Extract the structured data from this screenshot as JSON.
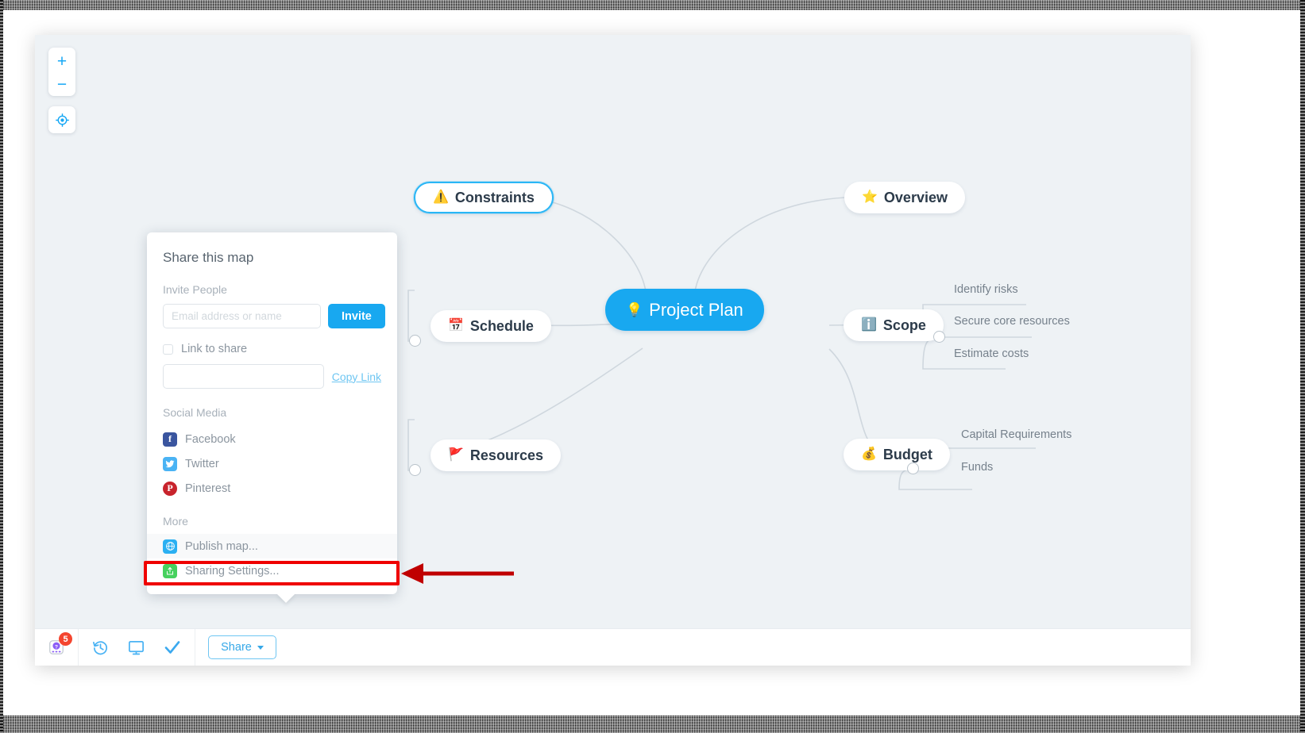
{
  "app": {
    "canvas_background": "#eef2f5",
    "accent": "#18a8f0"
  },
  "zoom_controls": {
    "zoom_in_label": "+",
    "zoom_out_label": "−",
    "recenter_name": "recenter-icon"
  },
  "mindmap": {
    "root": {
      "label": "Project Plan",
      "emoji": "💡"
    },
    "branches": [
      {
        "label": "Constraints",
        "emoji": "⚠️",
        "selected": true
      },
      {
        "label": "Overview",
        "emoji": "⭐",
        "selected": false
      },
      {
        "label": "Schedule",
        "emoji": "📅",
        "selected": false
      },
      {
        "label": "Scope",
        "emoji": "ℹ️",
        "selected": false
      },
      {
        "label": "Resources",
        "emoji": "🚩",
        "selected": false
      },
      {
        "label": "Budget",
        "emoji": "💰",
        "selected": false
      }
    ],
    "scope_children": [
      "Identify risks",
      "Secure core resources",
      "Estimate costs"
    ],
    "budget_children": [
      "Capital Requirements",
      "Funds"
    ]
  },
  "share_popover": {
    "title": "Share this map",
    "invite_section_label": "Invite People",
    "invite_placeholder": "Email address or name",
    "invite_value": "",
    "invite_button": "Invite",
    "link_to_share_label": "Link to share",
    "link_value": "",
    "copy_link_label": "Copy Link",
    "social_section_label": "Social Media",
    "social": [
      {
        "label": "Facebook",
        "icon": "facebook-icon",
        "glyph": "f",
        "color": "#3a559f"
      },
      {
        "label": "Twitter",
        "icon": "twitter-icon",
        "glyph": "🐦",
        "color": "#4ab3f4"
      },
      {
        "label": "Pinterest",
        "icon": "pinterest-icon",
        "glyph": "P",
        "color": "#c8232c"
      }
    ],
    "more_section_label": "More",
    "more": [
      {
        "label": "Publish map...",
        "icon": "globe-icon",
        "glyph": "⊕",
        "color": "#2bb0f2",
        "highlighted": true
      },
      {
        "label": "Sharing Settings...",
        "icon": "share-box-icon",
        "glyph": "↑",
        "color": "#46d15e",
        "highlighted": false
      }
    ]
  },
  "annotation": {
    "highlight_color": "#ef0000",
    "arrow_color": "#c00000",
    "target": "Publish map..."
  },
  "toolbar": {
    "help_badge_count": "5",
    "items": [
      {
        "name": "help-icon",
        "label": "Help"
      },
      {
        "name": "history-icon",
        "label": "History"
      },
      {
        "name": "present-icon",
        "label": "Presentation"
      },
      {
        "name": "check-icon",
        "label": "Tasks"
      }
    ],
    "share_button": "Share"
  }
}
